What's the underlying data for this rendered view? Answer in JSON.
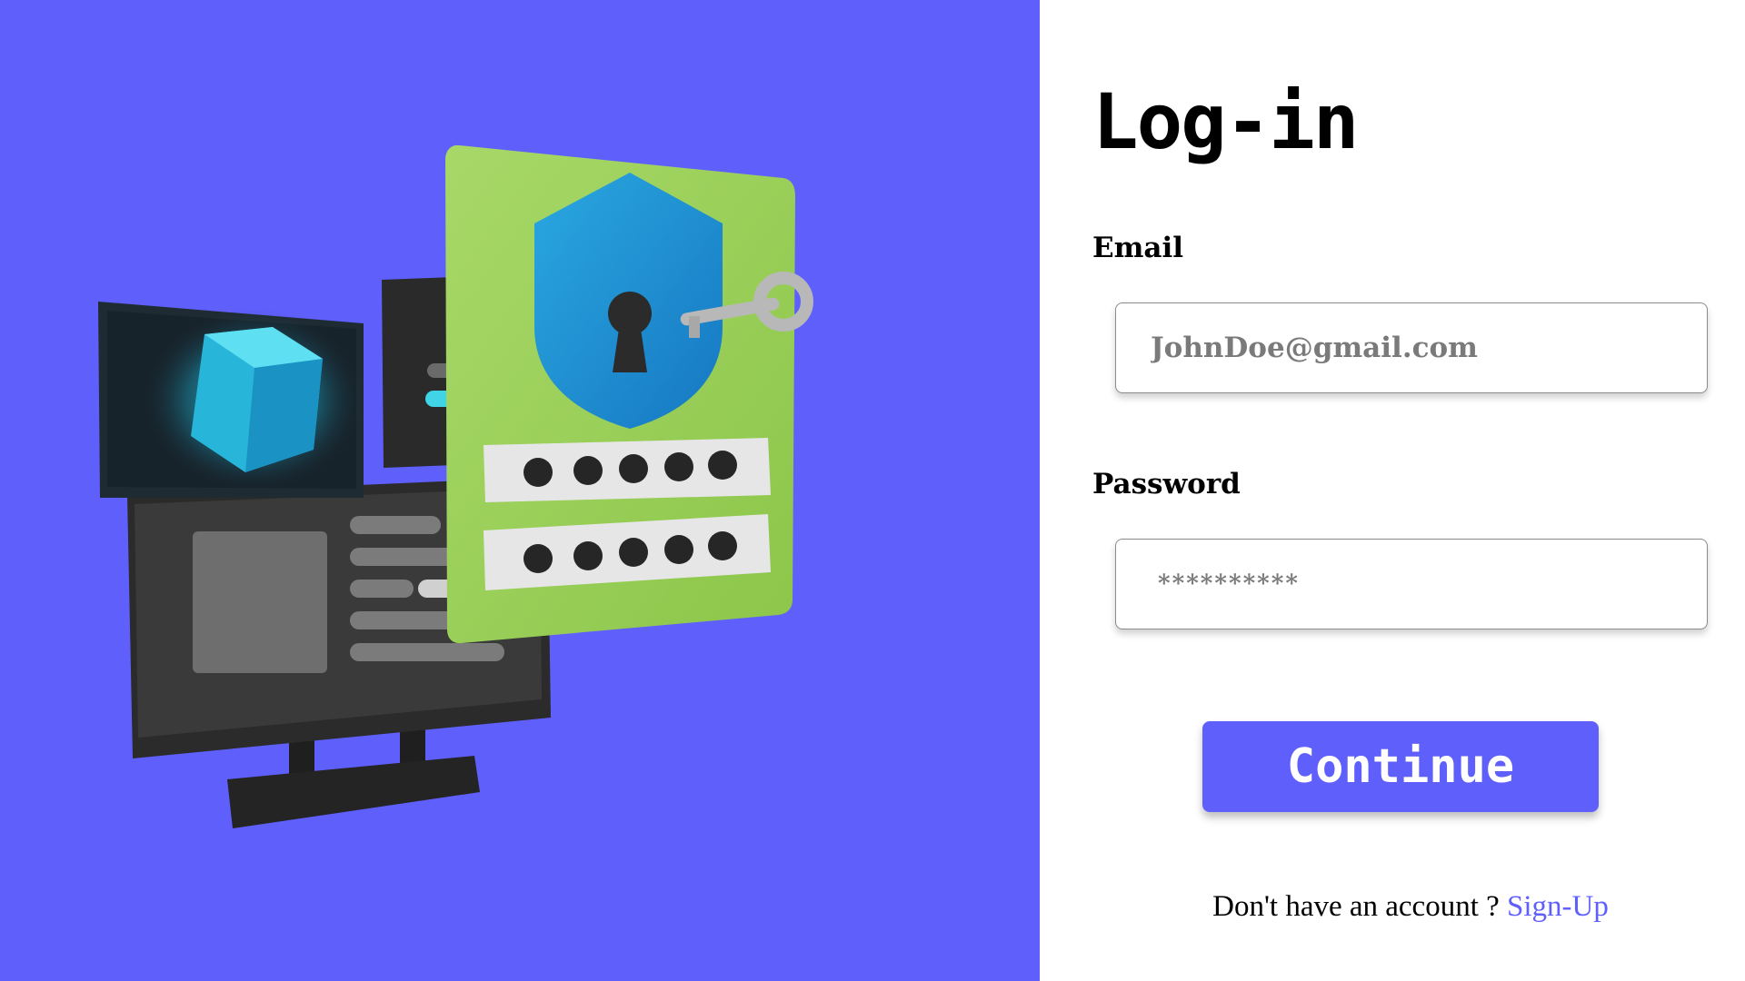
{
  "login": {
    "title": "Log-in",
    "email_label": "Email",
    "email_placeholder": "JohnDoe@gmail.com",
    "password_label": "Password",
    "password_placeholder": "**********",
    "continue_label": "Continue",
    "signup_prompt": "Don't have an account ? ",
    "signup_link": "Sign-Up"
  },
  "colors": {
    "accent": "#5f5ffc",
    "background": "#ffffff",
    "illustration_card": "#a6d35a",
    "illustration_shield": "#2196d3"
  },
  "illustration": {
    "icon_names": [
      "computer-monitor-icon",
      "security-card-icon",
      "shield-lock-icon",
      "key-icon",
      "password-field-icon"
    ]
  }
}
